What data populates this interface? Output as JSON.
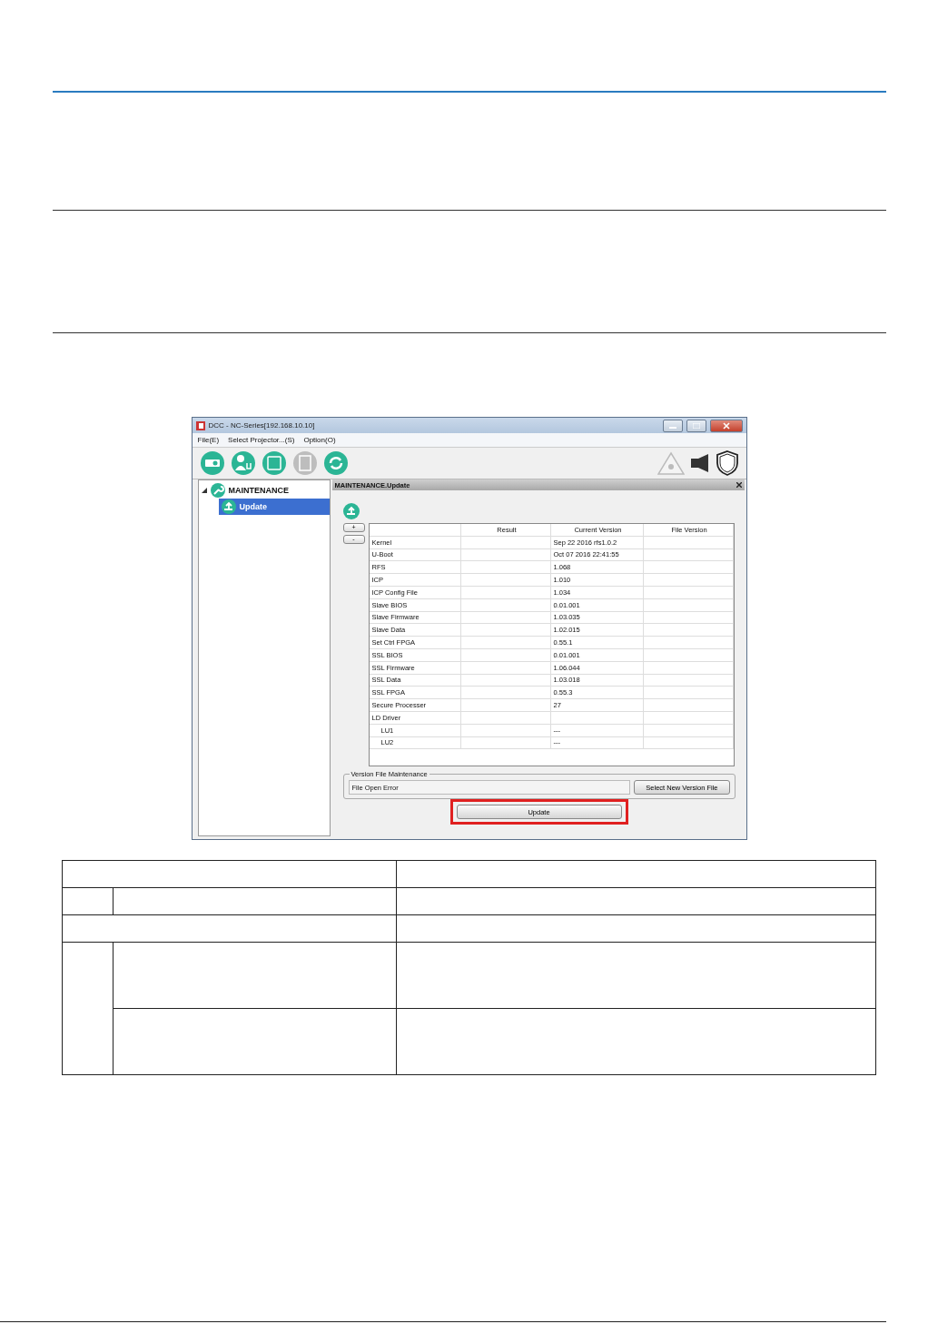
{
  "window": {
    "title": "DCC - NC-Series[192.168.10.10]"
  },
  "menu": [
    {
      "label": "File(E)"
    },
    {
      "label": "Select Projector...(S)"
    },
    {
      "label": "Option(O)"
    }
  ],
  "toolbar": [
    {
      "kind": "projector",
      "disabled": false
    },
    {
      "kind": "user",
      "disabled": false
    },
    {
      "kind": "log",
      "disabled": false
    },
    {
      "kind": "document",
      "disabled": true
    },
    {
      "kind": "refresh",
      "disabled": false
    }
  ],
  "tree": [
    {
      "label": "MAINTENANCE",
      "expanded": true,
      "selected": false,
      "children": [
        {
          "label": "Update",
          "selected": true
        }
      ]
    }
  ],
  "panel": {
    "title": "MAINTENANCE.Update",
    "zoom_buttons": [
      "+",
      "-"
    ],
    "columns": [
      "Result",
      "Current Version",
      "File Version"
    ],
    "rows": [
      {
        "name": "Kernel",
        "current": "Sep 22 2016 rfs1.0.2"
      },
      {
        "name": "U-Boot",
        "current": "Oct 07 2016 22:41:55"
      },
      {
        "name": "RFS",
        "current": "1.068"
      },
      {
        "name": "ICP",
        "current": "1.010"
      },
      {
        "name": "ICP Config File",
        "current": "1.034"
      },
      {
        "name": "Slave BIOS",
        "current": "0.01.001"
      },
      {
        "name": "Slave Firmware",
        "current": "1.03.035"
      },
      {
        "name": "Slave Data",
        "current": "1.02.015"
      },
      {
        "name": "Set Ctrl FPGA",
        "current": "0.55.1"
      },
      {
        "name": "SSL BIOS",
        "current": "0.01.001"
      },
      {
        "name": "SSL Firmware",
        "current": "1.06.044"
      },
      {
        "name": "SSL Data",
        "current": "1.03.018"
      },
      {
        "name": "SSL FPGA",
        "current": "0.55.3"
      },
      {
        "name": "Secure Processer",
        "current": "27"
      },
      {
        "name": "LD Driver",
        "children": [
          {
            "name": "LU1",
            "current": "---"
          },
          {
            "name": "LU2",
            "current": "---"
          }
        ]
      }
    ],
    "version_file": {
      "legend": "Version File Maintenance",
      "status": "File Open Error",
      "button": "Select New Version File"
    },
    "update_button": {
      "label": "Update",
      "highlighted": true
    }
  }
}
